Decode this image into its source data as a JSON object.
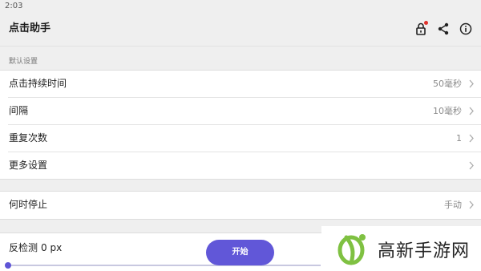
{
  "status": {
    "time": "2:03"
  },
  "app": {
    "title": "点击助手"
  },
  "icons": {
    "lock": "lock-icon",
    "share": "share-icon",
    "info": "info-icon",
    "chevron": "chevron-right-icon"
  },
  "section": {
    "default_settings": "默认设置"
  },
  "settings": {
    "rows": [
      {
        "label": "点击持续时间",
        "value": "50毫秒"
      },
      {
        "label": "间隔",
        "value": "10毫秒"
      },
      {
        "label": "重复次数",
        "value": "1"
      },
      {
        "label": "更多设置",
        "value": ""
      }
    ]
  },
  "stop": {
    "label": "何时停止",
    "value": "手动"
  },
  "bottom": {
    "anti_detect_label": "反检测",
    "anti_detect_value": "0 px",
    "start_label": "开始",
    "slider_fraction": 0.0
  },
  "watermark": {
    "text": "高新手游网"
  },
  "colors": {
    "accent": "#6157d8",
    "notification": "#e0322b",
    "logo_green": "#7fc142"
  }
}
